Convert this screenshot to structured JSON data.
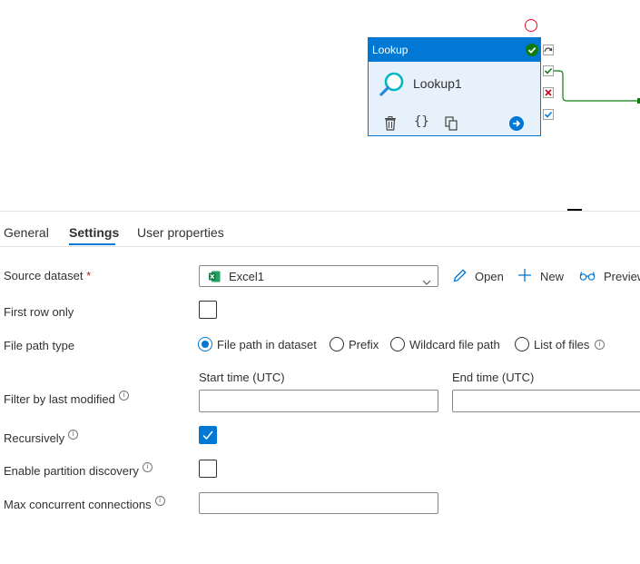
{
  "canvas": {
    "activity_type": "Lookup",
    "activity_name": "Lookup1"
  },
  "tabs": [
    {
      "label": "General",
      "active": false
    },
    {
      "label": "Settings",
      "active": true
    },
    {
      "label": "User properties",
      "active": false
    }
  ],
  "form": {
    "source_dataset": {
      "label": "Source dataset",
      "required_mark": "*",
      "value": "Excel1",
      "open_label": "Open",
      "new_label": "New",
      "preview_label": "Preview"
    },
    "first_row_only": {
      "label": "First row only",
      "checked": false
    },
    "file_path_type": {
      "label": "File path type",
      "options": [
        {
          "label": "File path in dataset",
          "selected": true
        },
        {
          "label": "Prefix",
          "selected": false
        },
        {
          "label": "Wildcard file path",
          "selected": false
        },
        {
          "label": "List of files",
          "selected": false
        }
      ]
    },
    "filter_by_last_modified": {
      "label": "Filter by last modified",
      "start_label": "Start time (UTC)",
      "end_label": "End time (UTC)",
      "start_value": "",
      "end_value": ""
    },
    "recursively": {
      "label": "Recursively",
      "checked": true
    },
    "enable_partition_discovery": {
      "label": "Enable partition discovery",
      "checked": false
    },
    "max_concurrent_connections": {
      "label": "Max concurrent connections",
      "value": ""
    }
  },
  "colors": {
    "accent": "#0078d4",
    "success": "#107c10",
    "failure": "#c50f1f",
    "excel": "#107c41"
  }
}
